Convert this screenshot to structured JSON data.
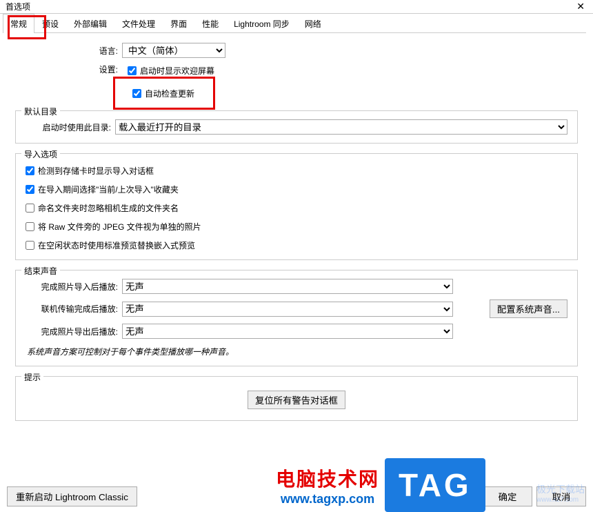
{
  "window": {
    "title": "首选项"
  },
  "tabs": {
    "items": [
      "常规",
      "预设",
      "外部编辑",
      "文件处理",
      "界面",
      "性能",
      "Lightroom 同步",
      "网络"
    ],
    "active_index": 0
  },
  "general": {
    "language_label": "语言:",
    "language_value": "中文（简体）",
    "settings_label": "设置:",
    "show_splash": {
      "label": "启动时显示欢迎屏幕",
      "checked": true
    },
    "auto_update": {
      "label": "自动检查更新",
      "checked": true
    }
  },
  "default_catalog": {
    "legend": "默认目录",
    "label": "启动时使用此目录:",
    "value": "载入最近打开的目录"
  },
  "import": {
    "legend": "导入选项",
    "items": [
      {
        "label": "检测到存储卡时显示导入对话框",
        "checked": true
      },
      {
        "label": "在导入期间选择\"当前/上次导入\"收藏夹",
        "checked": true
      },
      {
        "label": "命名文件夹时忽略相机生成的文件夹名",
        "checked": false
      },
      {
        "label": "将 Raw 文件旁的 JPEG 文件视为单独的照片",
        "checked": false
      },
      {
        "label": "在空闲状态时使用标准预览替换嵌入式预览",
        "checked": false
      }
    ]
  },
  "sound": {
    "legend": "结束声音",
    "rows": [
      {
        "label": "完成照片导入后播放:",
        "value": "无声"
      },
      {
        "label": "联机传输完成后播放:",
        "value": "无声"
      },
      {
        "label": "完成照片导出后播放:",
        "value": "无声"
      }
    ],
    "config_button": "配置系统声音...",
    "hint": "系统声音方案可控制对于每个事件类型播放哪一种声音。"
  },
  "prompt": {
    "legend": "提示",
    "reset_button": "复位所有警告对话框"
  },
  "footer": {
    "restart": "重新启动 Lightroom Classic",
    "ok": "确定",
    "cancel": "取消"
  },
  "overlay": {
    "logo1_cn": "电脑技术网",
    "logo1_url": "www.tagxp.com",
    "logo2": "TAG",
    "watermark_name": "极光下载站",
    "watermark_url": "www.xz7.com"
  }
}
